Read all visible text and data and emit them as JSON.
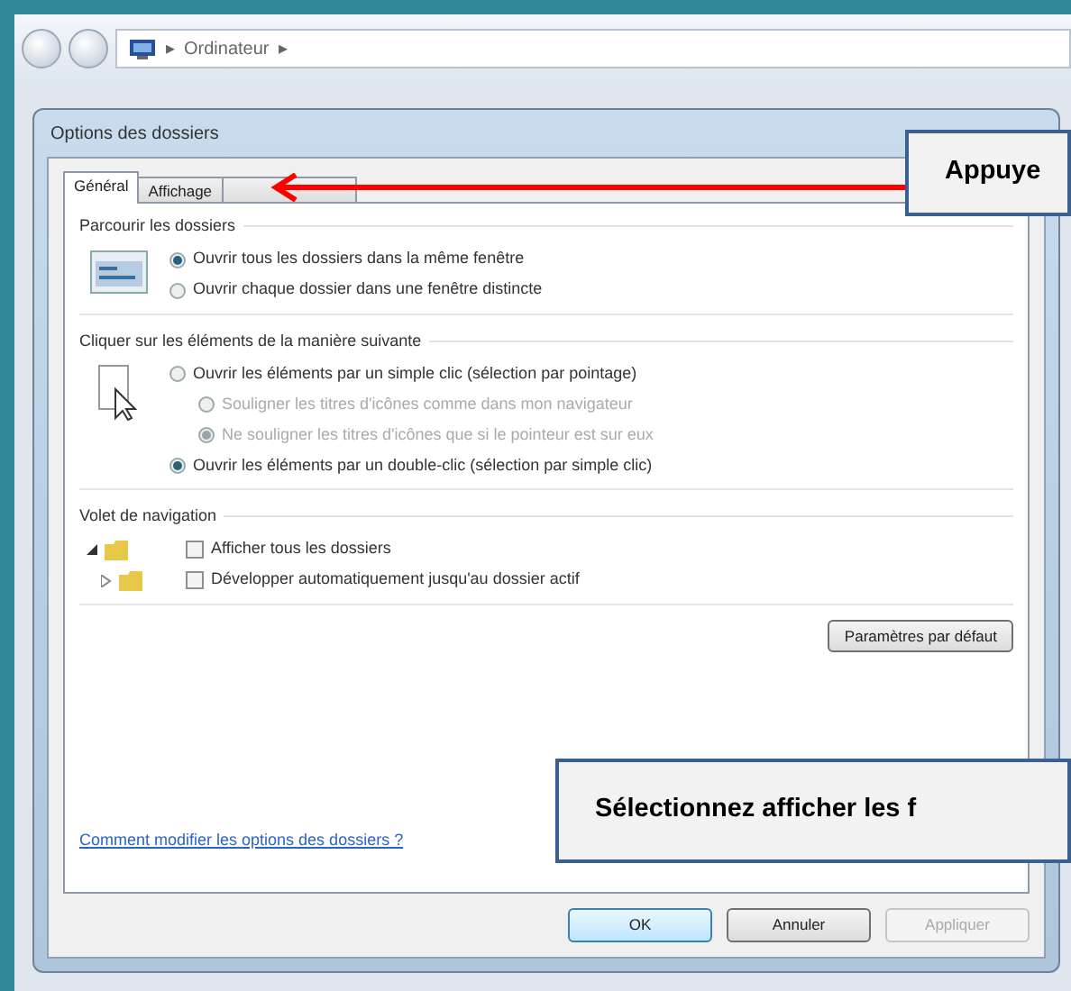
{
  "explorer": {
    "separator": "▸",
    "breadcrumb": [
      "Ordinateur"
    ],
    "trailing_separator": "▸"
  },
  "dialog": {
    "title": "Options des dossiers",
    "tabs": [
      {
        "label": "Général",
        "selected": true
      },
      {
        "label": "Affichage",
        "selected": false
      },
      {
        "selected": false
      }
    ],
    "groups": [
      {
        "title": "Parcourir les dossiers",
        "options": [
          {
            "kind": "radio",
            "label": "Ouvrir tous les dossiers dans la même fenêtre",
            "selected": true,
            "disabled": false
          },
          {
            "kind": "radio",
            "label": "Ouvrir chaque dossier dans une fenêtre distincte",
            "selected": false,
            "disabled": false
          }
        ]
      },
      {
        "title": "Cliquer sur les éléments de la manière suivante",
        "options": [
          {
            "kind": "radio",
            "label": "Ouvrir les éléments par un simple clic (sélection par pointage)",
            "selected": false,
            "disabled": false,
            "children": [
              {
                "kind": "radio",
                "label": "Souligner les titres d'icônes comme dans mon navigateur",
                "selected": false,
                "disabled": true
              },
              {
                "kind": "radio",
                "label": "Ne souligner les titres d'icônes que si le pointeur est sur eux",
                "selected": true,
                "disabled": true
              }
            ]
          },
          {
            "kind": "radio",
            "label": "Ouvrir les éléments par un double-clic (sélection par simple clic)",
            "selected": true,
            "disabled": false
          }
        ]
      },
      {
        "title": "Volet de navigation",
        "options": [
          {
            "kind": "checkbox",
            "label": "Afficher tous les dossiers",
            "checked": false,
            "disabled": false
          },
          {
            "kind": "checkbox",
            "label": "Développer automatiquement jusqu'au dossier actif",
            "checked": false,
            "disabled": false
          }
        ]
      }
    ],
    "defaults_button": "Paramètres par défaut",
    "help_link": "Comment modifier les options des dossiers ?",
    "buttons": [
      {
        "label": "OK",
        "disabled": false
      },
      {
        "label": "Annuler",
        "disabled": false
      },
      {
        "label": "Appliquer",
        "disabled": true
      }
    ]
  },
  "callouts": [
    {
      "text": "Appuye"
    },
    {
      "text": "Sélectionnez afficher les f"
    }
  ]
}
